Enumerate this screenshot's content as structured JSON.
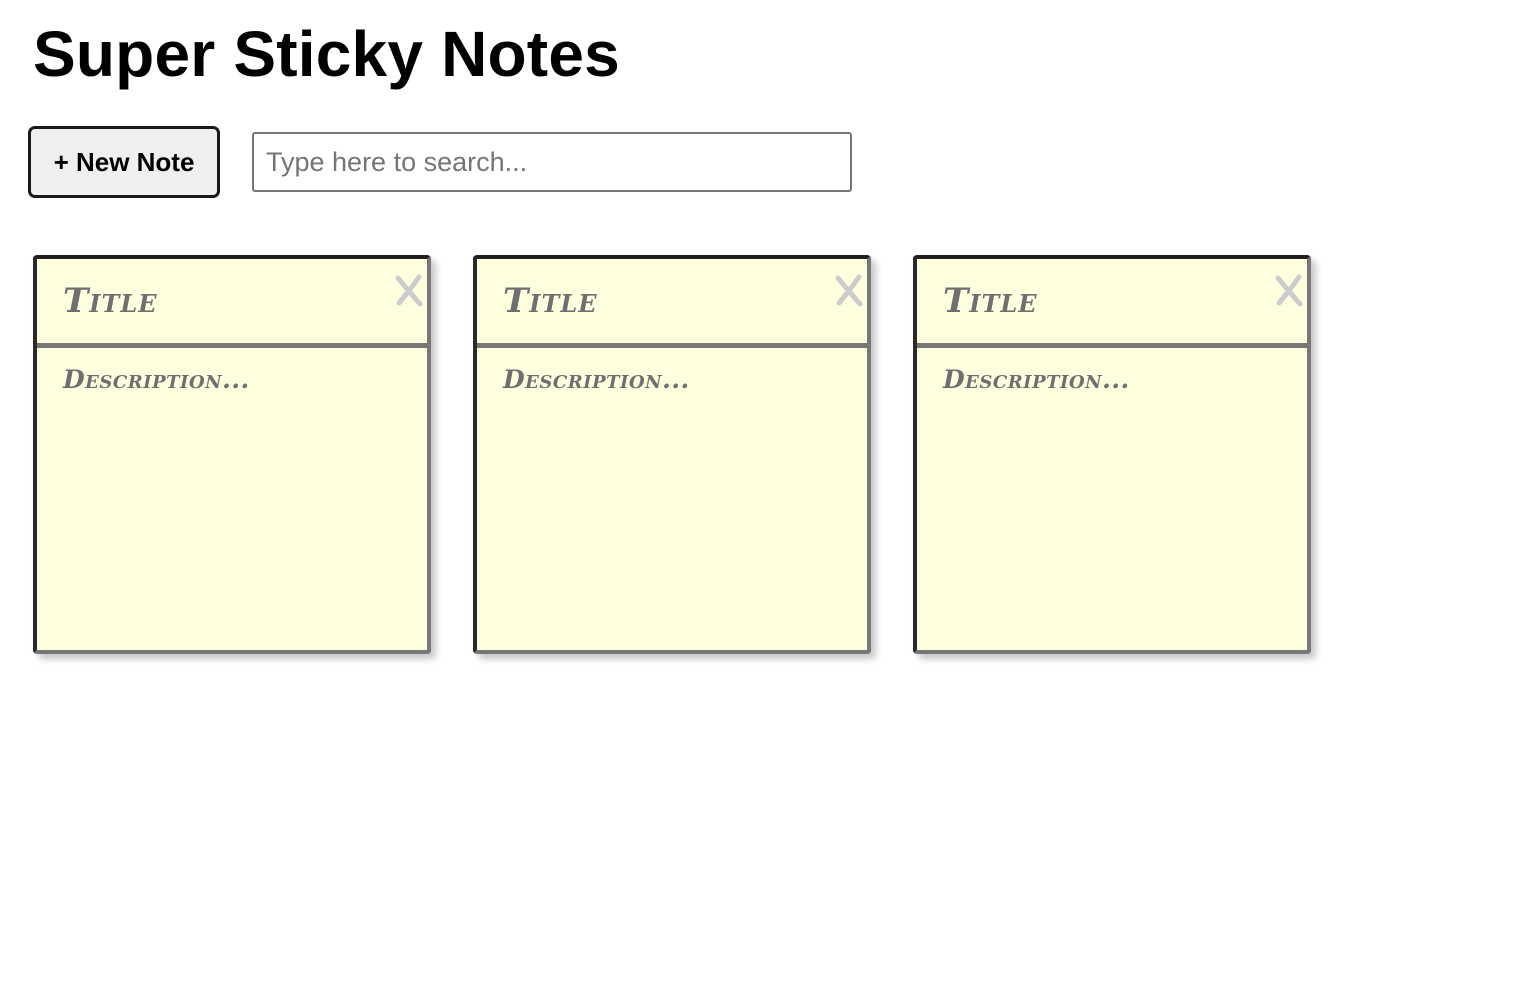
{
  "app": {
    "title": "Super Sticky Notes"
  },
  "toolbar": {
    "new_note_label": "+ New Note",
    "search": {
      "value": "",
      "placeholder": "Type here to search..."
    }
  },
  "notes": [
    {
      "title": "Title",
      "description": "Description...",
      "delete_icon": "close-icon"
    },
    {
      "title": "Title",
      "description": "Description...",
      "delete_icon": "close-icon"
    },
    {
      "title": "Title",
      "description": "Description...",
      "delete_icon": "close-icon"
    }
  ],
  "colors": {
    "note_background": "#ffffe0",
    "note_text": "#6f6f6f",
    "delete_icon": "#cccccc"
  }
}
